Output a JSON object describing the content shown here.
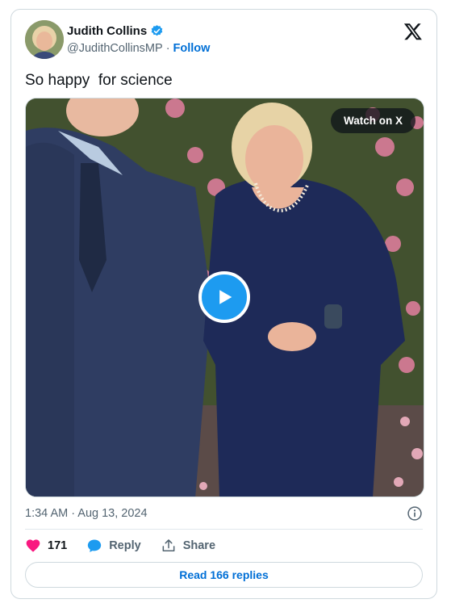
{
  "author": {
    "name": "Judith Collins",
    "handle": "@JudithCollinsMP",
    "separator": "·",
    "follow_label": "Follow"
  },
  "tweet": {
    "text": "So happy  for science",
    "timestamp": "1:34 AM · Aug 13, 2024"
  },
  "media": {
    "watch_label": "Watch on X"
  },
  "actions": {
    "likes": "171",
    "reply_label": "Reply",
    "share_label": "Share"
  },
  "read_replies_label": "Read 166 replies",
  "colors": {
    "like": "#f91880",
    "brand_blue": "#1d9bf0",
    "link": "#006fd6",
    "muted": "#536471"
  },
  "icons": [
    "verified-badge-icon",
    "x-logo-icon",
    "play-icon",
    "info-icon",
    "heart-icon",
    "reply-bubble-icon",
    "share-icon"
  ]
}
